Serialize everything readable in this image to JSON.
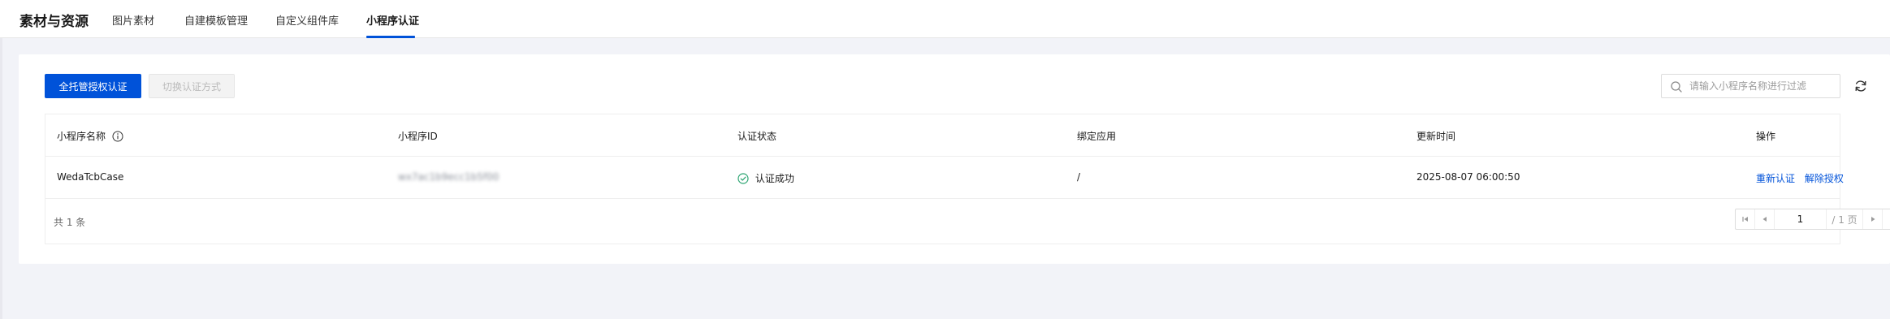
{
  "header": {
    "title": "素材与资源",
    "tabs": [
      {
        "label": "图片素材",
        "active": false
      },
      {
        "label": "自建模板管理",
        "active": false
      },
      {
        "label": "自定义组件库",
        "active": false
      },
      {
        "label": "小程序认证",
        "active": true
      }
    ]
  },
  "toolbar": {
    "primary_label": "全托管授权认证",
    "secondary_label": "切换认证方式",
    "search_placeholder": "请输入小程序名称进行过滤",
    "search_value": ""
  },
  "table": {
    "columns": [
      "小程序名称",
      "小程序ID",
      "认证状态",
      "绑定应用",
      "更新时间",
      "操作"
    ],
    "rows": [
      {
        "name": "WedaTcbCase",
        "app_id": "wx7ac1b9ecc1b5f00",
        "status": "认证成功",
        "bound_app": "/",
        "updated": "2025-08-07 06:00:50",
        "actions": [
          "重新认证",
          "解除授权"
        ]
      }
    ]
  },
  "pagination": {
    "total_text": "共 1 条",
    "current_page": "1",
    "total_pages_text": "/ 1 页"
  },
  "colors": {
    "accent": "#0052d9",
    "success": "#2ba471",
    "background": "#f2f3f8"
  },
  "icons": {
    "search": "search-icon",
    "refresh": "refresh-icon",
    "info": "info-icon",
    "status": "check-circle-icon"
  }
}
